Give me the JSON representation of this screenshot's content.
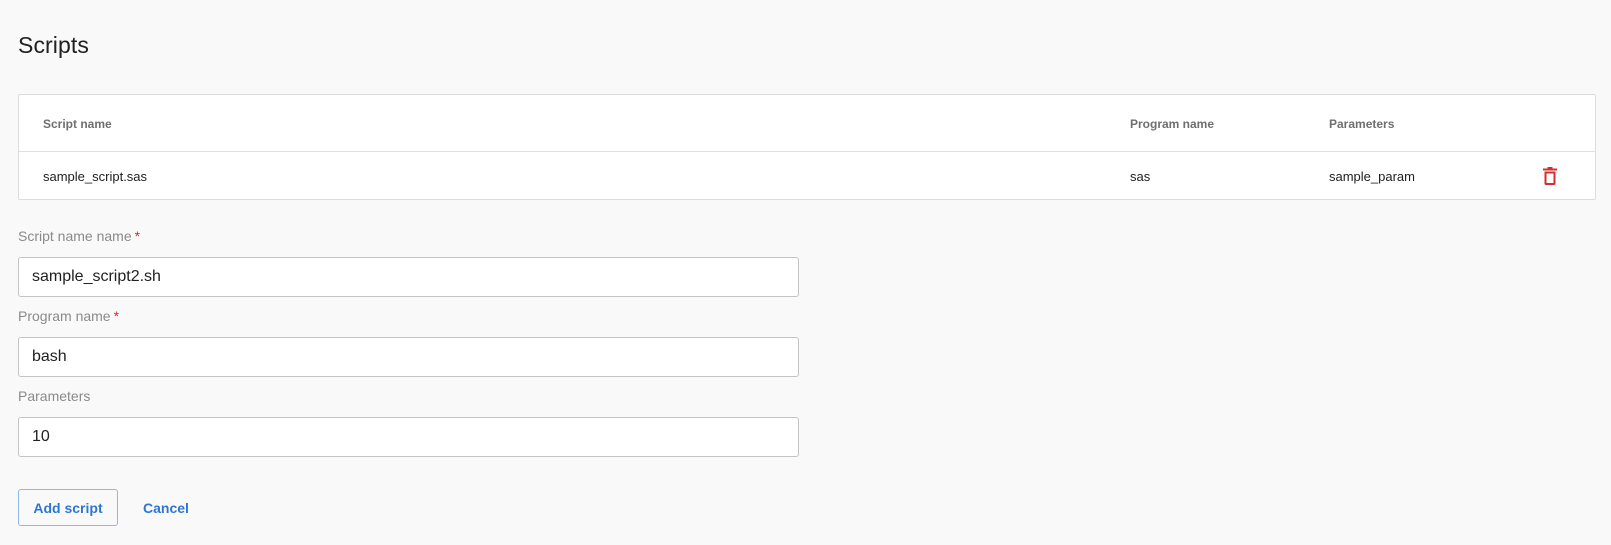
{
  "page": {
    "title": "Scripts"
  },
  "table": {
    "columns": {
      "script_name": "Script name",
      "program_name": "Program name",
      "parameters": "Parameters"
    },
    "rows": [
      {
        "script_name": "sample_script.sas",
        "program_name": "sas",
        "parameters": "sample_param",
        "action_icon": "trash-icon"
      }
    ]
  },
  "form": {
    "script_name": {
      "label": "Script name name",
      "required_mark": "*",
      "value": "sample_script2.sh"
    },
    "program_name": {
      "label": "Program name",
      "required_mark": "*",
      "value": "bash"
    },
    "parameters": {
      "label": "Parameters",
      "value": "10"
    }
  },
  "actions": {
    "add_label": "Add script",
    "cancel_label": "Cancel"
  },
  "colors": {
    "accent": "#2f76d2",
    "danger": "#d32f2f",
    "background": "#f9f9f9"
  }
}
